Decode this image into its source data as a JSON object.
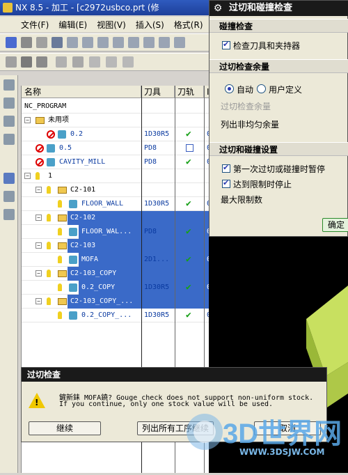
{
  "window": {
    "title": "NX 8.5 - 加工 - [c2972usbco.prt  (修"
  },
  "menu": [
    "文件(F)",
    "编辑(E)",
    "视图(V)",
    "插入(S)",
    "格式(R)"
  ],
  "tree": {
    "columns": [
      "名称",
      "刀具",
      "刀轨",
      "I"
    ],
    "rows": [
      {
        "name": "NC_PROGRAM",
        "tool": "",
        "path": "",
        "extra": "",
        "selected": false
      },
      {
        "name": "未用项",
        "tool": "",
        "path": "",
        "extra": "",
        "selected": false
      },
      {
        "name": "0.2",
        "tool": "1D30R5",
        "path": "check",
        "extra": "0",
        "selected": false
      },
      {
        "name": "0.5",
        "tool": "PD8",
        "path": "hollow",
        "extra": "0",
        "selected": false
      },
      {
        "name": "CAVITY_MILL",
        "tool": "PD8",
        "path": "check",
        "extra": "0",
        "selected": false
      },
      {
        "name": "1",
        "tool": "",
        "path": "",
        "extra": "",
        "selected": false
      },
      {
        "name": "C2-101",
        "tool": "",
        "path": "",
        "extra": "",
        "selected": false
      },
      {
        "name": "FLOOR_WALL",
        "tool": "1D30R5",
        "path": "check",
        "extra": "0",
        "selected": false
      },
      {
        "name": "C2-102",
        "tool": "",
        "path": "",
        "extra": "",
        "selected": true
      },
      {
        "name": "FLOOR_WAL...",
        "tool": "PD8",
        "path": "check",
        "extra": "0",
        "selected": true
      },
      {
        "name": "C2-103",
        "tool": "",
        "path": "",
        "extra": "",
        "selected": true
      },
      {
        "name": "MOFA",
        "tool": "2D1...",
        "path": "check",
        "extra": "0",
        "selected": true
      },
      {
        "name": "C2-103_COPY",
        "tool": "",
        "path": "",
        "extra": "",
        "selected": true
      },
      {
        "name": "0.2_COPY",
        "tool": "1D30R5",
        "path": "check",
        "extra": "0",
        "selected": true
      },
      {
        "name": "C2-103_COPY_...",
        "tool": "",
        "path": "",
        "extra": "",
        "selected": true
      },
      {
        "name": "0.2_COPY_...",
        "tool": "1D30R5",
        "path": "check",
        "extra": "0",
        "selected": false
      }
    ]
  },
  "dialog": {
    "title": "过切和碰撞检查",
    "section_collision": "碰撞检查",
    "check_tool_holder": "检查刀具和夹持器",
    "section_stock": "过切检查余量",
    "radio_auto": "自动",
    "radio_user": "用户定义",
    "stock_label": "过切检查余量",
    "list_nonuniform": "列出非均匀余量",
    "section_settings": "过切和碰撞设置",
    "pause_first": "第一次过切或碰撞时暂停",
    "stop_limit": "达到限制时停止",
    "max_limit": "最大限制数",
    "confirm": "确定"
  },
  "warning": {
    "title": "过切检查",
    "line1": "鏟新銇 MOFA鐃? Gouge check does not support non-uniform stock.",
    "line2": "If you continue, only one stock value will be used.",
    "continue": "继续",
    "list_all": "列出所有工序继续",
    "cancel": "取消"
  },
  "watermark": {
    "main": "3D世界网",
    "url": "WWW.3DSJW.COM"
  },
  "colors": {
    "selection": "#3a6ac8",
    "title": "#1a1a1a",
    "face": "#ece9d8",
    "model": "#c8e060"
  }
}
